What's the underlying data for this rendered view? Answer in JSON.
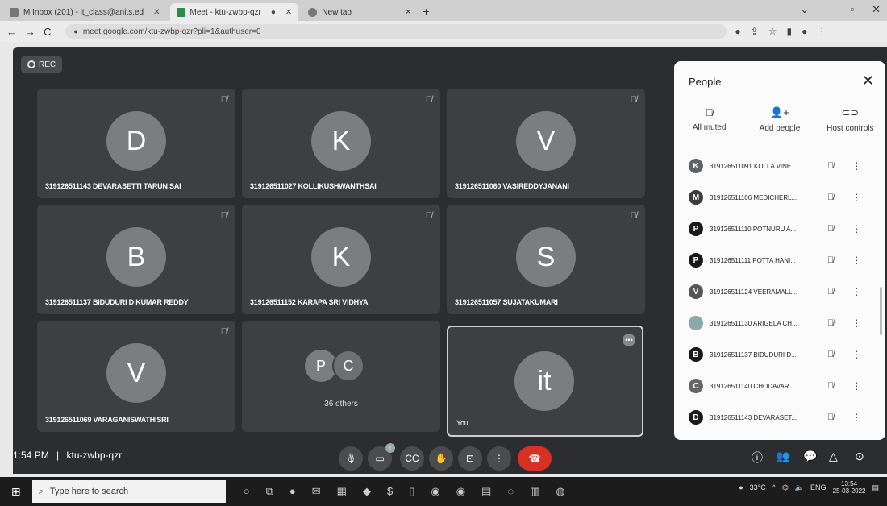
{
  "browser": {
    "tabs": [
      {
        "label": "M Inbox (201) - it_class@anits.ed"
      },
      {
        "label": "Meet - ktu-zwbp-qzr"
      },
      {
        "label": "New tab"
      }
    ],
    "url": "meet.google.com/ktu-zwbp-qzr?pli=1&authuser=0"
  },
  "meet": {
    "rec_label": "REC",
    "time": "1:54 PM",
    "separator": "|",
    "code": "ktu-zwbp-qzr",
    "tiles": [
      {
        "initial": "D",
        "name": "319126511143 DEVARASETTI TARUN SAI"
      },
      {
        "initial": "K",
        "name": "319126511027 KOLLIKUSHWANTHSAI"
      },
      {
        "initial": "V",
        "name": "319126511060 VASIREDDYJANANI"
      },
      {
        "initial": "B",
        "name": "319126511137 BIDUDURI D KUMAR REDDY"
      },
      {
        "initial": "K",
        "name": "319126511152 KARAPA SRI VIDHYA"
      },
      {
        "initial": "S",
        "name": "319126511057 SUJATAKUMARI"
      },
      {
        "initial": "V",
        "name": "319126511069 VARAGANISWATHISRI"
      }
    ],
    "others": {
      "a": "P",
      "b": "C",
      "label": "36 others"
    },
    "you": {
      "initial": "it",
      "label": "You"
    }
  },
  "people": {
    "title": "People",
    "actions": [
      {
        "label": "All muted",
        "icon": "mic-off-icon"
      },
      {
        "label": "Add people",
        "icon": "add-person-icon"
      },
      {
        "label": "Host controls",
        "icon": "toggle-icon"
      }
    ],
    "list": [
      {
        "initial": "K",
        "name": "319126511091 KOLLA VINE...",
        "color": "#5f6368"
      },
      {
        "initial": "M",
        "name": "319126511106 MEDICHERL...",
        "color": "#3c3c3c"
      },
      {
        "initial": "P",
        "name": "319126511110 POTNURU A...",
        "color": "#1a1a1a"
      },
      {
        "initial": "P",
        "name": "319126511111 POTTA HANI...",
        "color": "#1a1a1a"
      },
      {
        "initial": "V",
        "name": "319126511124 VEERAMALL...",
        "color": "#555"
      },
      {
        "initial": "",
        "name": "319126511130 ARIGELA CH...",
        "color": "#8aa"
      },
      {
        "initial": "B",
        "name": "319126511137 BIDUDURI D...",
        "color": "#1a1a1a"
      },
      {
        "initial": "C",
        "name": "319126511140 CHODAVAR...",
        "color": "#666"
      },
      {
        "initial": "D",
        "name": "319126511143 DEVARASET...",
        "color": "#1a1a1a"
      }
    ]
  },
  "taskbar": {
    "search_placeholder": "Type here to search",
    "temp": "33°C",
    "lang": "ENG",
    "clock_time": "13:54",
    "clock_date": "25-03-2022"
  }
}
